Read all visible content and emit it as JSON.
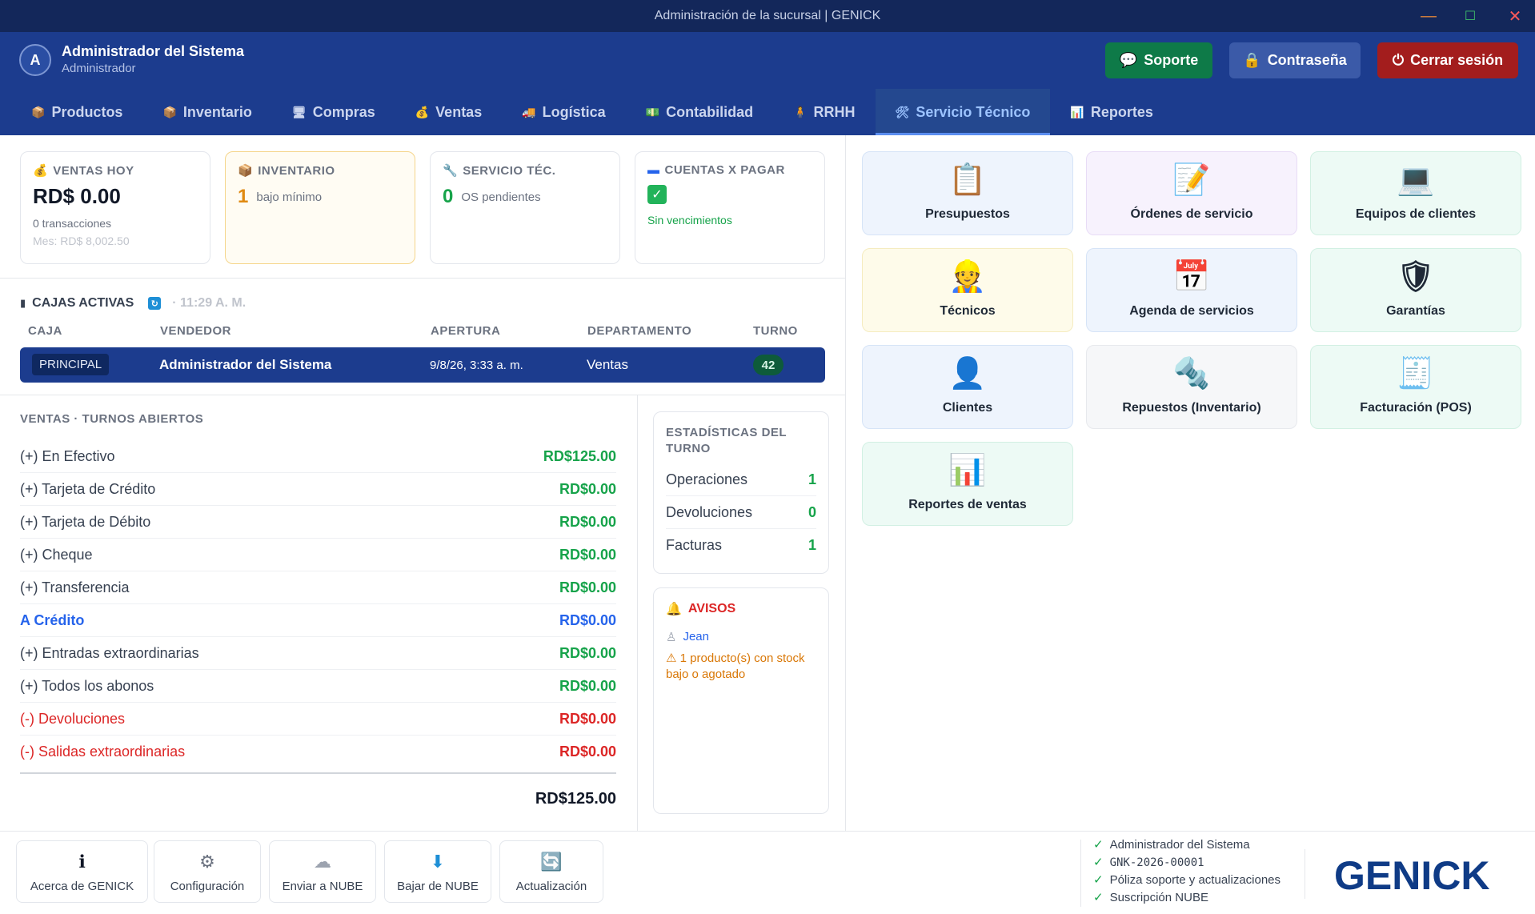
{
  "window": {
    "title": "Administración de la sucursal | GENICK"
  },
  "user": {
    "initial": "A",
    "name": "Administrador del Sistema",
    "role": "Administrador"
  },
  "top_buttons": {
    "soporte": "Soporte",
    "contrasena": "Contraseña",
    "cerrar": "Cerrar sesión"
  },
  "tabs": [
    {
      "icon": "📦",
      "label": "Productos"
    },
    {
      "icon": "📦",
      "label": "Inventario"
    },
    {
      "icon": "🖥",
      "label": "Compras"
    },
    {
      "icon": "💰",
      "label": "Ventas"
    },
    {
      "icon": "🚚",
      "label": "Logística"
    },
    {
      "icon": "💵",
      "label": "Contabilidad"
    },
    {
      "icon": "🧍",
      "label": "RRHH"
    },
    {
      "icon": "🛠",
      "label": "Servicio Técnico"
    },
    {
      "icon": "📊",
      "label": "Reportes"
    }
  ],
  "active_tab": "Servicio Técnico",
  "cards": {
    "ventas": {
      "title": "VENTAS HOY",
      "value": "RD$ 0.00",
      "sub1": "0 transacciones",
      "sub2": "Mes: RD$ 8,002.50"
    },
    "inventario": {
      "title": "INVENTARIO",
      "value": "1",
      "sub": "bajo mínimo"
    },
    "servicio": {
      "title": "SERVICIO TÉC.",
      "value": "0",
      "sub": "OS pendientes"
    },
    "cuentas": {
      "title": "CUENTAS X PAGAR",
      "sub": "Sin vencimientos"
    }
  },
  "cajas": {
    "title": "CAJAS ACTIVAS",
    "time": "· 11:29 A. M.",
    "headers": [
      "CAJA",
      "VENDEDOR",
      "APERTURA",
      "DEPARTAMENTO",
      "TURNO"
    ],
    "row": {
      "caja": "PRINCIPAL",
      "vendedor": "Administrador del Sistema",
      "apertura": "9/8/26, 3:33 a. m.",
      "departamento": "Ventas",
      "turno": "42"
    }
  },
  "ventas_turnos": {
    "title": "VENTAS · TURNOS ABIERTOS",
    "lines": [
      {
        "label": "(+) En Efectivo",
        "amount": "RD$125.00",
        "kind": "normal"
      },
      {
        "label": "(+) Tarjeta de Crédito",
        "amount": "RD$0.00",
        "kind": "normal"
      },
      {
        "label": "(+) Tarjeta de Débito",
        "amount": "RD$0.00",
        "kind": "normal"
      },
      {
        "label": "(+) Cheque",
        "amount": "RD$0.00",
        "kind": "normal"
      },
      {
        "label": "(+) Transferencia",
        "amount": "RD$0.00",
        "kind": "normal"
      },
      {
        "label": "A Crédito",
        "amount": "RD$0.00",
        "kind": "credit"
      },
      {
        "label": "(+) Entradas extraordinarias",
        "amount": "RD$0.00",
        "kind": "normal"
      },
      {
        "label": "(+) Todos los abonos",
        "amount": "RD$0.00",
        "kind": "normal"
      },
      {
        "label": "(-) Devoluciones",
        "amount": "RD$0.00",
        "kind": "negative"
      },
      {
        "label": "(-) Salidas extraordinarias",
        "amount": "RD$0.00",
        "kind": "negative"
      }
    ],
    "total": "RD$125.00"
  },
  "stats": {
    "title": "ESTADÍSTICAS DEL TURNO",
    "rows": [
      {
        "label": "Operaciones",
        "value": "1"
      },
      {
        "label": "Devoluciones",
        "value": "0"
      },
      {
        "label": "Facturas",
        "value": "1"
      }
    ]
  },
  "avisos": {
    "title": "AVISOS",
    "user": "Jean",
    "warning": "1 producto(s) con stock bajo o agotado"
  },
  "modules": [
    {
      "label": "Presupuestos",
      "icon": "📋",
      "bg": "#eef4fd",
      "border": "#d6e4f7"
    },
    {
      "label": "Órdenes de servicio",
      "icon": "📝",
      "bg": "#f7f2fd",
      "border": "#e8dcf6"
    },
    {
      "label": "Equipos de clientes",
      "icon": "💻",
      "bg": "#edfaf5",
      "border": "#d2f0e3"
    },
    {
      "label": "Técnicos",
      "icon": "👷",
      "bg": "#fefbea",
      "border": "#f5ecc0"
    },
    {
      "label": "Agenda de servicios",
      "icon": "📅",
      "bg": "#eef4fd",
      "border": "#d6e4f7"
    },
    {
      "label": "Garantías",
      "icon": "🛡",
      "bg": "#edfaf5",
      "border": "#d2f0e3"
    },
    {
      "label": "Clientes",
      "icon": "👤",
      "bg": "#eef4fd",
      "border": "#d6e4f7"
    },
    {
      "label": "Repuestos (Inventario)",
      "icon": "🔩",
      "bg": "#f6f7f9",
      "border": "#e7e9ed"
    },
    {
      "label": "Facturación (POS)",
      "icon": "🧾",
      "bg": "#edfaf5",
      "border": "#d2f0e3"
    },
    {
      "label": "Reportes de ventas",
      "icon": "📊",
      "bg": "#edfaf5",
      "border": "#d2f0e3"
    }
  ],
  "bottom_buttons": [
    {
      "label": "Acerca de GENICK",
      "icon": "ℹ"
    },
    {
      "label": "Configuración",
      "icon": "⚙"
    },
    {
      "label": "Enviar a NUBE",
      "icon": "☁"
    },
    {
      "label": "Bajar de NUBE",
      "icon": "⬇"
    },
    {
      "label": "Actualización",
      "icon": "🔄"
    }
  ],
  "license": [
    "Administrador del Sistema",
    "GNK-2026-00001",
    "Póliza soporte y actualizaciones",
    "Suscripción NUBE"
  ],
  "logo": "GENICK",
  "colors": {
    "brand": "#1c3c8e",
    "soporte": "#0e7a48",
    "contrasena": "#3b5aa8",
    "cerrar": "#a31d1d",
    "positive": "#16a34a",
    "negative": "#dc2626",
    "credit": "#2563eb"
  }
}
